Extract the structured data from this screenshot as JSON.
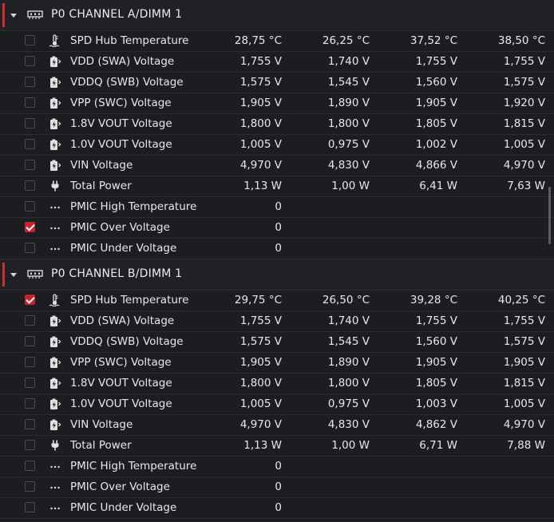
{
  "colors": {
    "accent": "#d52b2b",
    "background": "#1b1c1e",
    "text": "#e8e8e8"
  },
  "sections": [
    {
      "title": "P0 CHANNEL A/DIMM 1",
      "rows": [
        {
          "icon": "thermometer-icon",
          "checked": false,
          "name": "SPD Hub Temperature",
          "v1": "28,75 °C",
          "v2": "26,25 °C",
          "v3": "37,52 °C",
          "v4": "38,50 °C"
        },
        {
          "icon": "battery-charge-icon",
          "checked": false,
          "name": "VDD (SWA) Voltage",
          "v1": "1,755 V",
          "v2": "1,740 V",
          "v3": "1,755 V",
          "v4": "1,755 V"
        },
        {
          "icon": "battery-charge-icon",
          "checked": false,
          "name": "VDDQ (SWB) Voltage",
          "v1": "1,575 V",
          "v2": "1,545 V",
          "v3": "1,560 V",
          "v4": "1,575 V"
        },
        {
          "icon": "battery-charge-icon",
          "checked": false,
          "name": "VPP (SWC) Voltage",
          "v1": "1,905 V",
          "v2": "1,890 V",
          "v3": "1,905 V",
          "v4": "1,920 V"
        },
        {
          "icon": "battery-charge-icon",
          "checked": false,
          "name": "1.8V VOUT Voltage",
          "v1": "1,800 V",
          "v2": "1,800 V",
          "v3": "1,805 V",
          "v4": "1,815 V"
        },
        {
          "icon": "battery-charge-icon",
          "checked": false,
          "name": "1.0V VOUT Voltage",
          "v1": "1,005 V",
          "v2": "0,975 V",
          "v3": "1,002 V",
          "v4": "1,005 V"
        },
        {
          "icon": "battery-charge-icon",
          "checked": false,
          "name": "VIN Voltage",
          "v1": "4,970 V",
          "v2": "4,830 V",
          "v3": "4,866 V",
          "v4": "4,970 V"
        },
        {
          "icon": "plug-icon",
          "checked": false,
          "name": "Total Power",
          "v1": "1,13 W",
          "v2": "1,00 W",
          "v3": "6,41 W",
          "v4": "7,63 W"
        },
        {
          "icon": "dots-icon",
          "checked": false,
          "name": "PMIC High Temperature",
          "v1": "0",
          "v2": "",
          "v3": "",
          "v4": ""
        },
        {
          "icon": "dots-icon",
          "checked": true,
          "name": "PMIC Over Voltage",
          "v1": "0",
          "v2": "",
          "v3": "",
          "v4": ""
        },
        {
          "icon": "dots-icon",
          "checked": false,
          "name": "PMIC Under Voltage",
          "v1": "0",
          "v2": "",
          "v3": "",
          "v4": ""
        }
      ]
    },
    {
      "title": "P0 CHANNEL B/DIMM 1",
      "rows": [
        {
          "icon": "thermometer-icon",
          "checked": true,
          "name": "SPD Hub Temperature",
          "v1": "29,75 °C",
          "v2": "26,50 °C",
          "v3": "39,28 °C",
          "v4": "40,25 °C"
        },
        {
          "icon": "battery-charge-icon",
          "checked": false,
          "name": "VDD (SWA) Voltage",
          "v1": "1,755 V",
          "v2": "1,740 V",
          "v3": "1,755 V",
          "v4": "1,755 V"
        },
        {
          "icon": "battery-charge-icon",
          "checked": false,
          "name": "VDDQ (SWB) Voltage",
          "v1": "1,575 V",
          "v2": "1,545 V",
          "v3": "1,560 V",
          "v4": "1,575 V"
        },
        {
          "icon": "battery-charge-icon",
          "checked": false,
          "name": "VPP (SWC) Voltage",
          "v1": "1,905 V",
          "v2": "1,890 V",
          "v3": "1,905 V",
          "v4": "1,905 V"
        },
        {
          "icon": "battery-charge-icon",
          "checked": false,
          "name": "1.8V VOUT Voltage",
          "v1": "1,800 V",
          "v2": "1,800 V",
          "v3": "1,805 V",
          "v4": "1,815 V"
        },
        {
          "icon": "battery-charge-icon",
          "checked": false,
          "name": "1.0V VOUT Voltage",
          "v1": "1,005 V",
          "v2": "0,975 V",
          "v3": "1,003 V",
          "v4": "1,005 V"
        },
        {
          "icon": "battery-charge-icon",
          "checked": false,
          "name": "VIN Voltage",
          "v1": "4,970 V",
          "v2": "4,830 V",
          "v3": "4,862 V",
          "v4": "4,970 V"
        },
        {
          "icon": "plug-icon",
          "checked": false,
          "name": "Total Power",
          "v1": "1,13 W",
          "v2": "1,00 W",
          "v3": "6,71 W",
          "v4": "7,88 W"
        },
        {
          "icon": "dots-icon",
          "checked": false,
          "name": "PMIC High Temperature",
          "v1": "0",
          "v2": "",
          "v3": "",
          "v4": ""
        },
        {
          "icon": "dots-icon",
          "checked": false,
          "name": "PMIC Over Voltage",
          "v1": "0",
          "v2": "",
          "v3": "",
          "v4": ""
        },
        {
          "icon": "dots-icon",
          "checked": false,
          "name": "PMIC Under Voltage",
          "v1": "0",
          "v2": "",
          "v3": "",
          "v4": ""
        }
      ]
    }
  ]
}
